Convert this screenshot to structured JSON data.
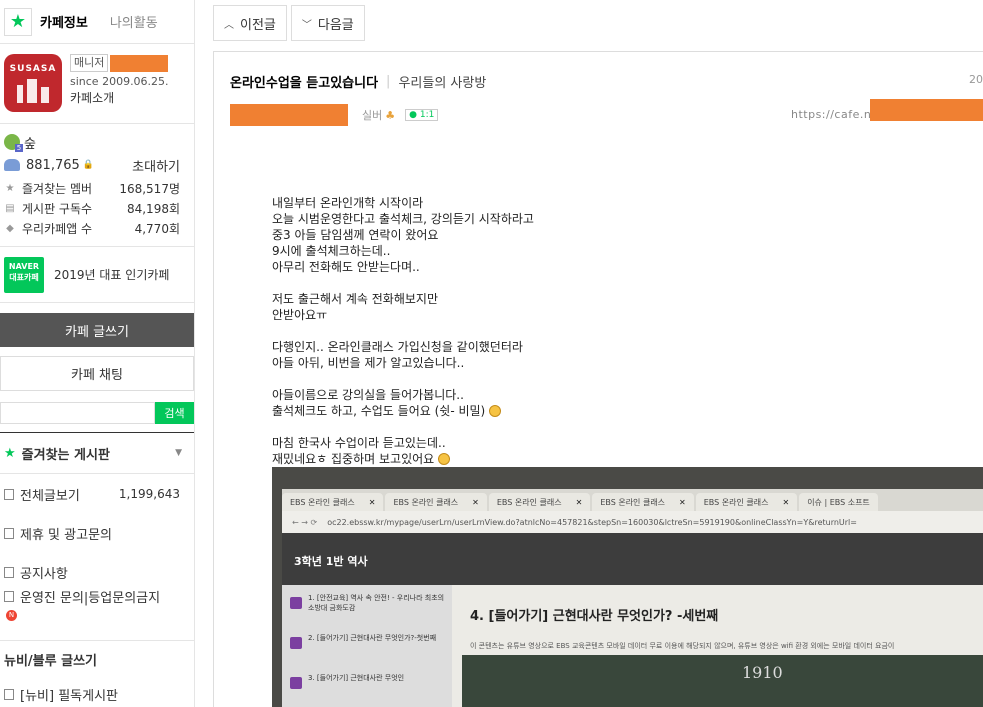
{
  "sidebar": {
    "tabs": [
      "카페정보",
      "나의활동"
    ],
    "logo_text": "SUSASA",
    "manager_label": "매니저",
    "since": "since 2009.06.25.",
    "intro_link": "카페소개",
    "level": "숲",
    "member_count": "881,765",
    "invite_label": "초대하기",
    "stats": [
      {
        "label": "즐겨찾는 멤버",
        "value": "168,517명",
        "icon": "star-icon"
      },
      {
        "label": "게시판 구독수",
        "value": "84,198회",
        "icon": "rss-icon"
      },
      {
        "label": "우리카페앱 수",
        "value": "4,770회",
        "icon": "app-icon"
      }
    ],
    "award_badge": [
      "NAVER",
      "대표카페"
    ],
    "award_text": "2019년 대표 인기카페",
    "write_button": "카페 글쓰기",
    "chat_button": "카페 채팅",
    "search_button": "검색",
    "favorites_header": "즐겨찾는 게시판",
    "boards": [
      {
        "label": "전체글보기",
        "count": "1,199,643"
      },
      {
        "label": "제휴 및 광고문의",
        "count": ""
      },
      {
        "label": "공지사항",
        "count": ""
      },
      {
        "label": "운영진 문의|등업문의금지",
        "count": ""
      }
    ],
    "new_badge": "N",
    "newbie_header": "뉴비/블루 글쓰기",
    "newbie_board": "[뉴비] 필독게시판"
  },
  "main": {
    "prev_button": "이전글",
    "next_button": "다음글",
    "article_title": "온라인수업을 듣고있습니다",
    "board_name": "우리들의 사랑방",
    "date_fragment": "20",
    "grade": "실버",
    "comment_count": "1:1",
    "url_prefix": "https://cafe.na",
    "body_lines": [
      "내일부터 온라인개학 시작이라",
      "오늘 시범운영한다고 출석체크, 강의듣기 시작하라고",
      "중3 아들 담임샘께 연락이 왔어요",
      "9시에 출석체크하는데..",
      "아무리 전화해도 안받는다며..",
      "",
      "저도 출근해서 계속 전화해보지만",
      "안받아요ㅠ",
      "",
      "다행인지.. 온라인클래스 가입신청을 같이했던터라",
      "아들 아뒤, 비번을 제가 알고있습니다..",
      "",
      "아들이름으로 강의실을 들어가봅니다..",
      "출석체크도 하고, 수업도 들어요 (쉿- 비밀)",
      "",
      "마침 한국사 수업이라 듣고있는데..",
      "재밌네요ㅎ 집중하며 보고있어요"
    ],
    "photo": {
      "tabs": [
        "EBS 온라인 클래스",
        "EBS 온라인 클래스",
        "EBS 온라인 클래스",
        "EBS 온라인 클래스",
        "EBS 온라인 클래스",
        "이슈 | EBS 소프트"
      ],
      "url": "oc22.ebssw.kr/mypage/userLrn/userLrnView.do?atnlcNo=457821&stepSn=160030&lctreSn=5919190&onlineClassYn=Y&returnUrl=",
      "class_title": "3학년 1반 역사",
      "lessons": [
        "1. [안전교육] 역사 속 안전! - 우리나라 최초의 소방대 금화도감",
        "2. [들어가기] 근현대사란 무엇인가?-첫번째",
        "3. [들어가기] 근현대사란 무엇인"
      ],
      "lesson_heading": "4. [들어가기] 근현대사란 무엇인가? -세번째",
      "notice": "이 콘텐츠는 유튜브 영상으로 EBS 교육콘텐츠 모바일 데이터 무료 이용에 해당되지 않으며, 유튜브 영상은 wifi 환경 외에는 모바일 데이터 요금이",
      "chalk": "1910"
    }
  }
}
